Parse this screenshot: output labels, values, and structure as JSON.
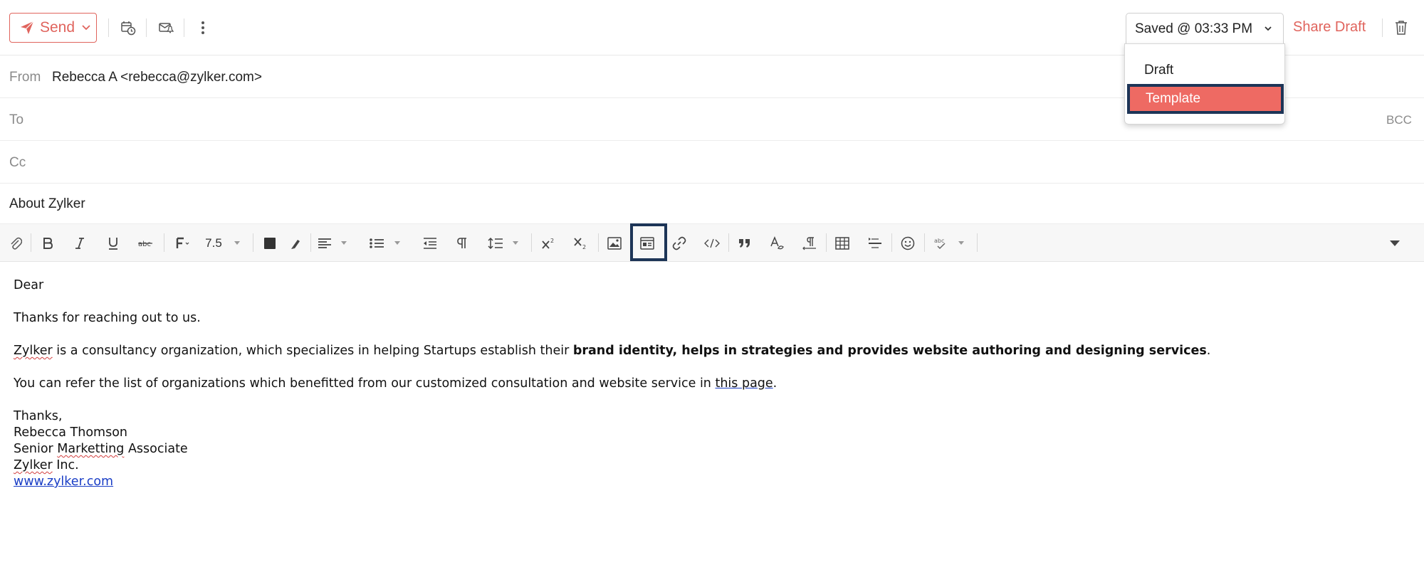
{
  "toolbar": {
    "send_label": "Send",
    "saved_label": "Saved @ 03:33 PM",
    "share_draft_label": "Share Draft"
  },
  "save_menu": {
    "items": [
      {
        "label": "Draft"
      },
      {
        "label": "Template",
        "selected": true
      }
    ]
  },
  "header": {
    "from_label": "From",
    "from_value": "Rebecca A <rebecca@zylker.com>",
    "to_label": "To",
    "bcc_label": "BCC",
    "cc_label": "Cc",
    "subject": "About Zylker"
  },
  "format_toolbar": {
    "font_size": "7.5"
  },
  "body": {
    "greeting": "Dear",
    "line1": "Thanks for reaching out to us.",
    "line2_word": "Zylker",
    "line2_pre": " is a consultancy organization, which specializes in helping Startups establish their ",
    "line2_bold": "brand identity, helps in strategies and provides website authoring and designing services",
    "line2_post": ".",
    "line3_pre": "You can refer the list of organizations which benefitted from our customized consultation and website service in ",
    "line3_link": "this page",
    "line3_post": ".",
    "sign_off": "Thanks,",
    "sig_name": "Rebecca Thomson",
    "sig_title_pre": "Senior ",
    "sig_title_word": "Marketting",
    "sig_title_post": " Associate",
    "sig_company_word": "Zylker",
    "sig_company_post": " Inc.",
    "sig_website": "www.zylker.com"
  },
  "colors": {
    "accent": "#e0645d",
    "menu_selected_bg": "#ee6a63",
    "highlight_border": "#1d3557",
    "link": "#1a3ec6"
  }
}
